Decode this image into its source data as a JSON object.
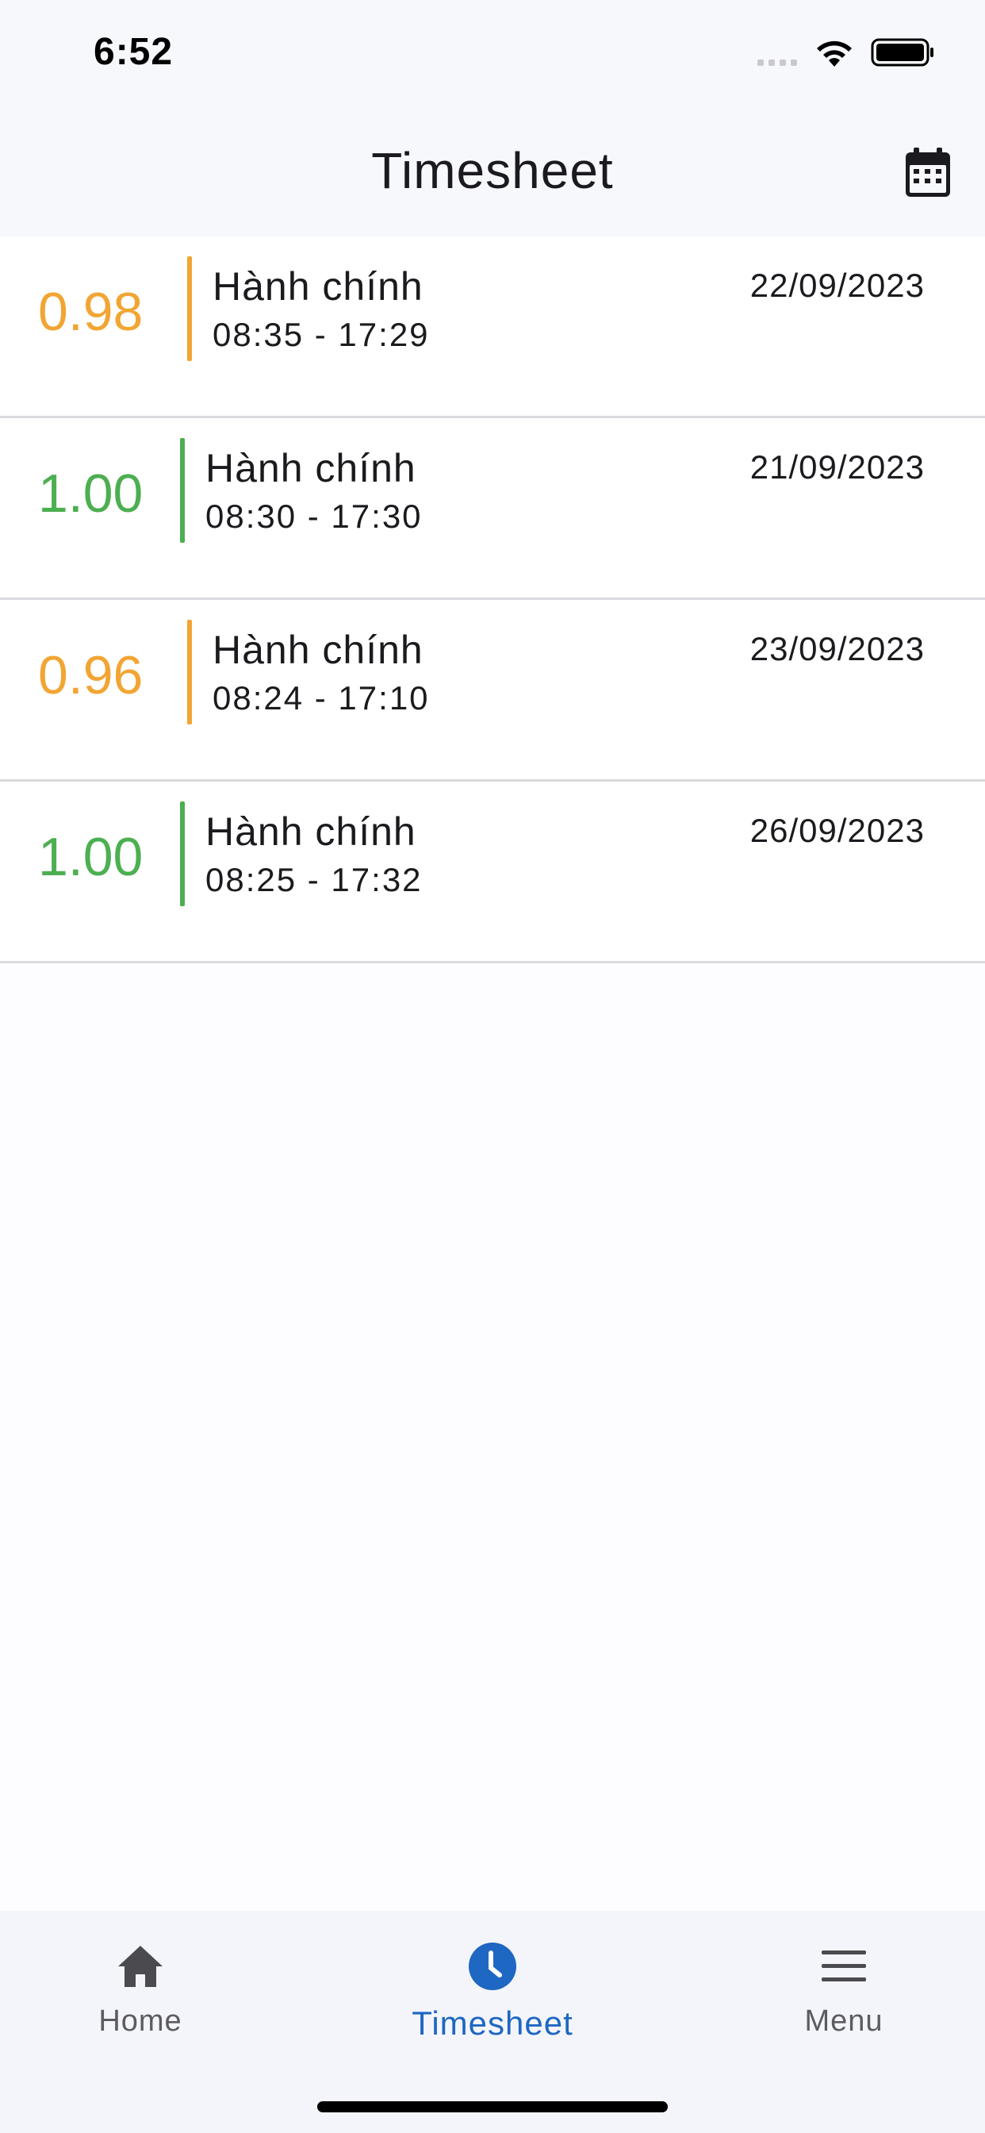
{
  "status_bar": {
    "time": "6:52"
  },
  "header": {
    "title": "Timesheet",
    "calendar_icon": "calendar-icon"
  },
  "colors": {
    "partial": "#f2a533",
    "full": "#4caf50",
    "accent": "#1e67c2"
  },
  "entries": [
    {
      "value": "0.98",
      "status": "partial",
      "shift": "Hành chính",
      "hours": "08:35 - 17:29",
      "date": "22/09/2023"
    },
    {
      "value": "1.00",
      "status": "full",
      "shift": "Hành chính",
      "hours": "08:30 - 17:30",
      "date": "21/09/2023"
    },
    {
      "value": "0.96",
      "status": "partial",
      "shift": "Hành chính",
      "hours": "08:24 - 17:10",
      "date": "23/09/2023"
    },
    {
      "value": "1.00",
      "status": "full",
      "shift": "Hành chính",
      "hours": "08:25 - 17:32",
      "date": "26/09/2023"
    }
  ],
  "nav": {
    "items": [
      {
        "label": "Home",
        "icon": "home-icon"
      },
      {
        "label": "Timesheet",
        "icon": "clock-icon",
        "active": true
      },
      {
        "label": "Menu",
        "icon": "menu-icon"
      }
    ]
  }
}
